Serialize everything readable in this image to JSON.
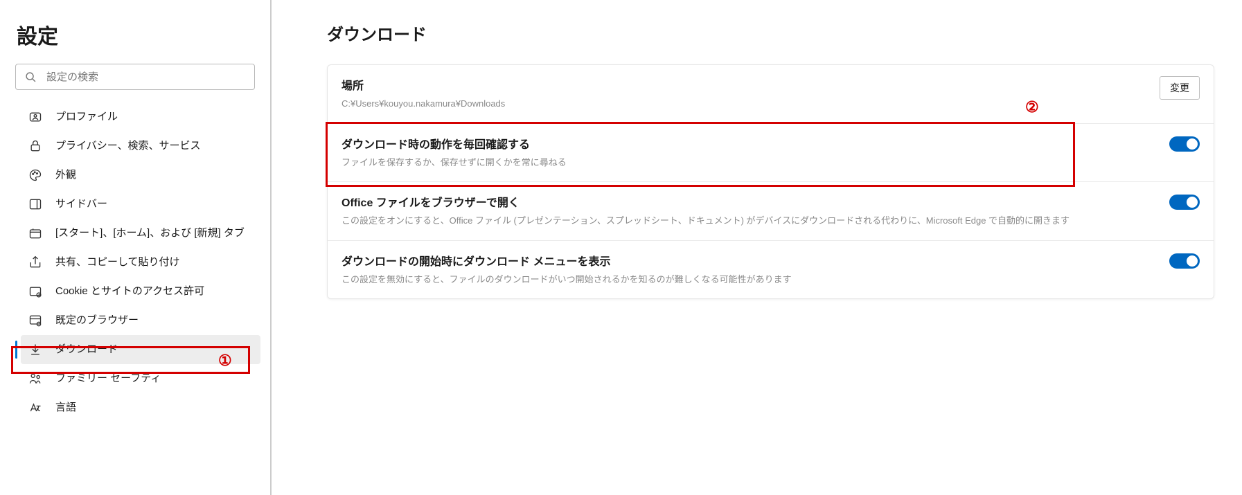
{
  "sidebar": {
    "title": "設定",
    "search_placeholder": "設定の検索",
    "items": [
      {
        "label": "プロファイル"
      },
      {
        "label": "プライバシー、検索、サービス"
      },
      {
        "label": "外観"
      },
      {
        "label": "サイドバー"
      },
      {
        "label": "[スタート]、[ホーム]、および [新規] タブ"
      },
      {
        "label": "共有、コピーして貼り付け"
      },
      {
        "label": "Cookie とサイトのアクセス許可"
      },
      {
        "label": "既定のブラウザー"
      },
      {
        "label": "ダウンロード"
      },
      {
        "label": "ファミリー セーフティ"
      },
      {
        "label": "言語"
      }
    ]
  },
  "main": {
    "title": "ダウンロード",
    "location": {
      "title": "場所",
      "path": "C:¥Users¥kouyou.nakamura¥Downloads",
      "button": "変更"
    },
    "ask": {
      "title": "ダウンロード時の動作を毎回確認する",
      "desc": "ファイルを保存するか、保存せずに開くかを常に尋ねる"
    },
    "office": {
      "title": "Office ファイルをブラウザーで開く",
      "desc": "この設定をオンにすると、Office ファイル (プレゼンテーション、スプレッドシート、ドキュメント) がデバイスにダウンロードされる代わりに、Microsoft Edge で自動的に開きます"
    },
    "menu": {
      "title": "ダウンロードの開始時にダウンロード メニューを表示",
      "desc": "この設定を無効にすると、ファイルのダウンロードがいつ開始されるかを知るのが難しくなる可能性があります"
    }
  },
  "annotations": {
    "a1": "①",
    "a2": "②"
  }
}
